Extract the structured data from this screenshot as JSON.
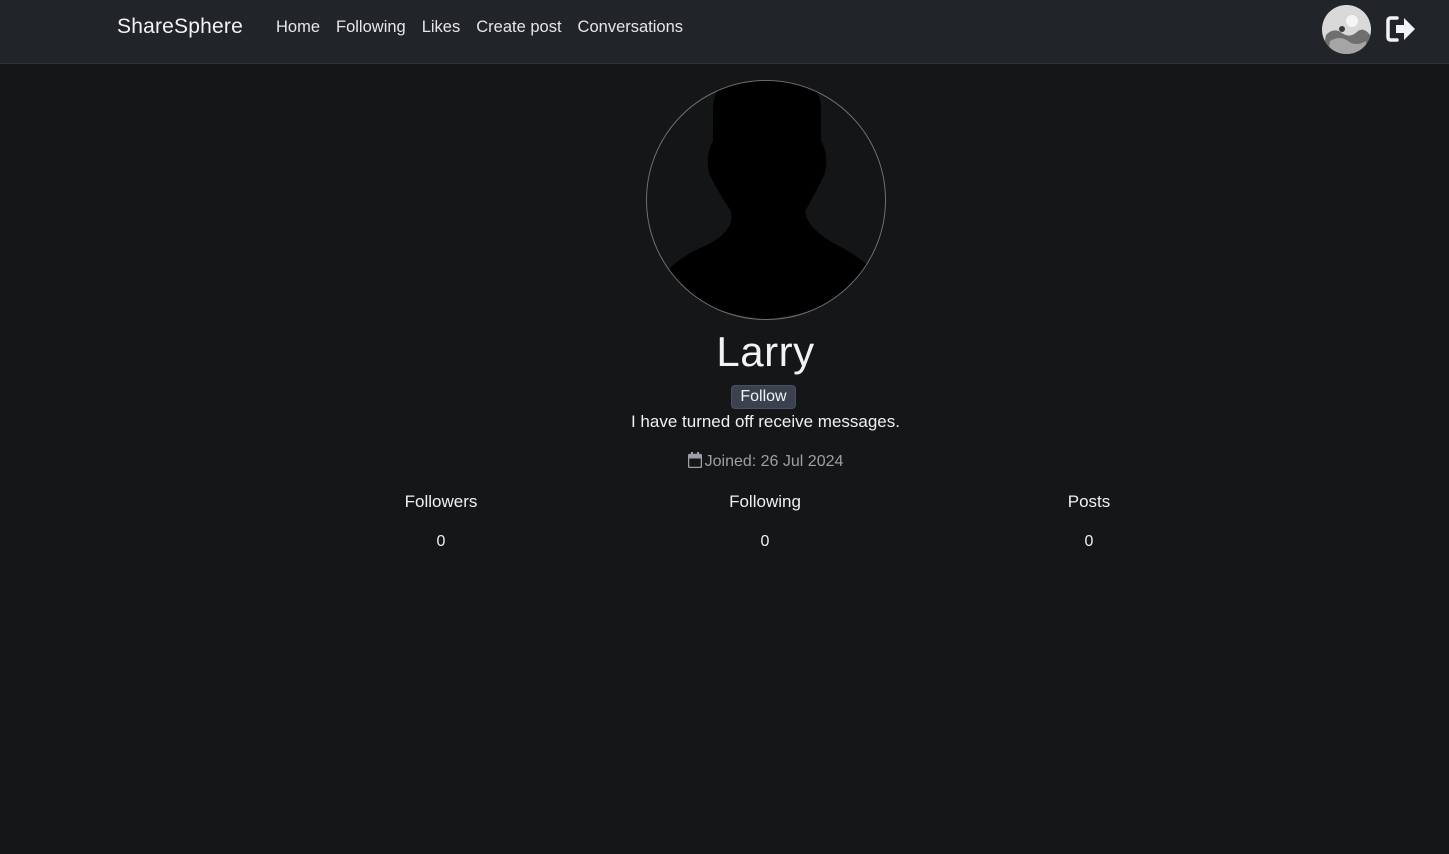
{
  "navbar": {
    "brand": "ShareSphere",
    "links": [
      "Home",
      "Following",
      "Likes",
      "Create post",
      "Conversations"
    ],
    "user_avatar_icon": "user-avatar-icon",
    "logout_icon": "logout-icon"
  },
  "profile": {
    "avatar_icon": "default-user-silhouette-icon",
    "username": "Larry",
    "follow_label": "Follow",
    "message_note": "I have turned off receive messages.",
    "joined_icon": "calendar-icon",
    "joined_text": "Joined: 26 Jul 2024"
  },
  "stats": [
    {
      "label": "Followers",
      "value": "0"
    },
    {
      "label": "Following",
      "value": "0"
    },
    {
      "label": "Posts",
      "value": "0"
    }
  ],
  "colors": {
    "background": "#151618",
    "navbar": "#212429",
    "follow_button": "#3c4150",
    "muted_text": "#9aa0a6"
  }
}
